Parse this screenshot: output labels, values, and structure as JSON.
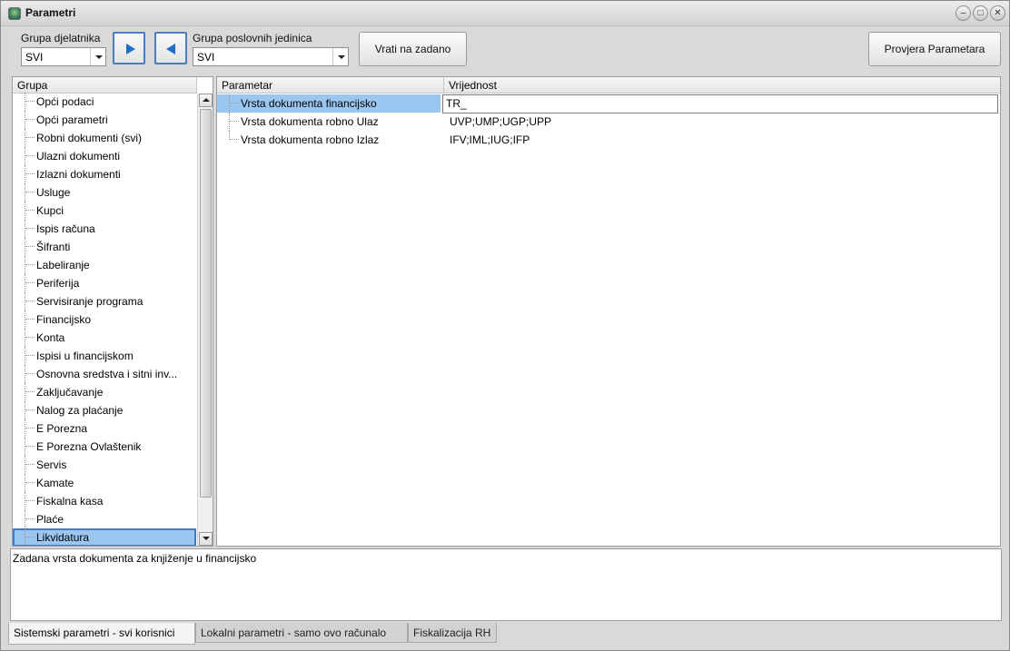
{
  "window": {
    "title": "Parametri"
  },
  "toolbar": {
    "group_activity_label": "Grupa djelatnika",
    "group_activity_value": "SVI",
    "group_units_label": "Grupa poslovnih jedinica",
    "group_units_value": "SVI",
    "reset_label": "Vrati na zadano",
    "check_label": "Provjera Parametara"
  },
  "tree": {
    "header": "Grupa",
    "items": [
      "Opći podaci",
      "Opći parametri",
      "Robni dokumenti (svi)",
      "Ulazni dokumenti",
      "Izlazni dokumenti",
      "Usluge",
      "Kupci",
      "Ispis računa",
      "Šifranti",
      "Labeliranje",
      "Periferija",
      "Servisiranje programa",
      "Financijsko",
      "Konta",
      "Ispisi u financijskom",
      "Osnovna sredstva i sitni inv...",
      "Zaključavanje",
      "Nalog za plaćanje",
      "E Porezna",
      "E Porezna Ovlaštenik",
      "Servis",
      "Kamate",
      "Fiskalna kasa",
      "Plaće",
      "Likvidatura"
    ],
    "selected": "Likvidatura"
  },
  "grid": {
    "header_param": "Parametar",
    "header_value": "Vrijednost",
    "rows": [
      {
        "name": "Vrsta dokumenta financijsko",
        "value": "TR_"
      },
      {
        "name": "Vrsta dokumenta robno Ulaz",
        "value": "UVP;UMP;UGP;UPP"
      },
      {
        "name": "Vrsta dokumenta robno Izlaz",
        "value": "IFV;IML;IUG;IFP"
      }
    ]
  },
  "description": "Zadana vrsta dokumenta za knjiženje u financijsko",
  "tabs": [
    "Sistemski parametri - svi korisnici",
    "Lokalni parametri - samo ovo računalo",
    "Fiskalizacija RH"
  ],
  "colors": {
    "selection": "#9bc6ef",
    "accent": "#1f6fc4"
  }
}
